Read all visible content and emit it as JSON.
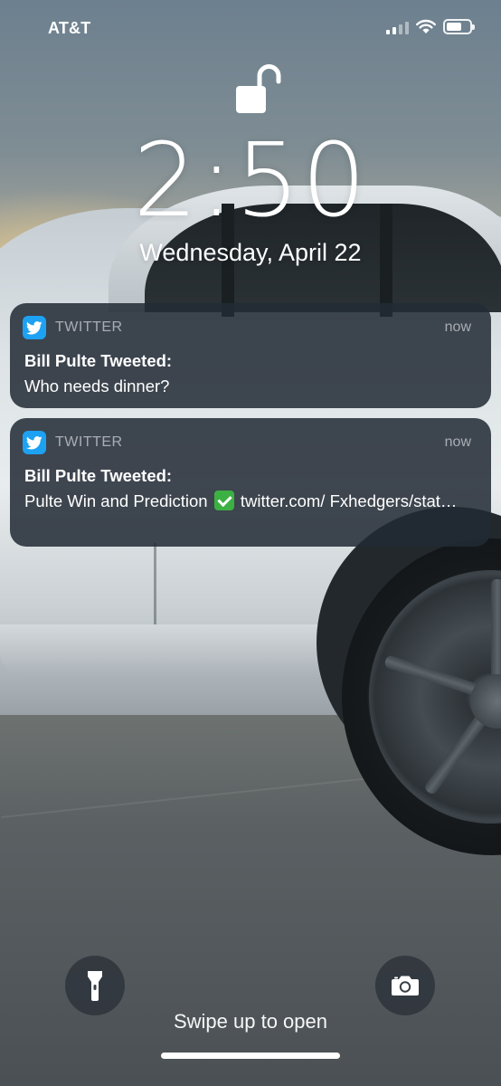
{
  "status_bar": {
    "carrier": "AT&T",
    "signal_bars": 2,
    "signal_bars_total": 4,
    "battery_level": 0.65
  },
  "lock_screen": {
    "time": "2:50",
    "date": "Wednesday, April 22",
    "lock_state": "unlocked",
    "swipe_hint": "Swipe up to open"
  },
  "notifications": [
    {
      "app": "TWITTER",
      "time": "now",
      "title": "Bill Pulte Tweeted:",
      "body": "Who needs dinner?"
    },
    {
      "app": "TWITTER",
      "time": "now",
      "title": "Bill Pulte Tweeted:",
      "body_before_emoji": "Pulte Win and Prediction",
      "body_after_emoji": "twitter.com/ Fxhedgers/stat…"
    }
  ],
  "icons": {
    "app_icon": "twitter-bird-icon",
    "lock": "unlocked-padlock-icon",
    "flashlight": "flashlight-icon",
    "camera": "camera-icon",
    "emoji": "white-check-mark-emoji"
  },
  "colors": {
    "twitter_blue": "#1da1f2",
    "notification_bg": "rgba(34,42,52,0.86)",
    "check_green": "#3cb043"
  }
}
